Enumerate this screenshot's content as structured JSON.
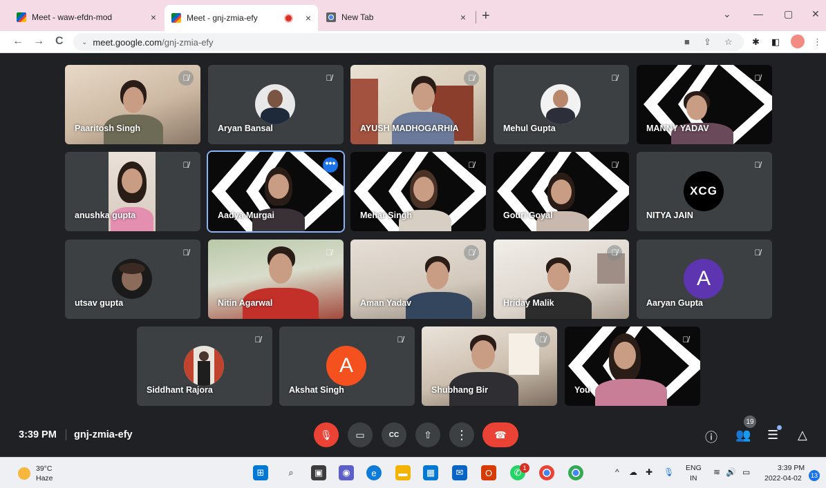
{
  "browser": {
    "tabs": [
      {
        "title": "Meet - waw-efdn-mod",
        "close": "×"
      },
      {
        "title": "Meet - gnj-zmia-efy",
        "close": "×"
      },
      {
        "title": "New Tab",
        "close": "×"
      }
    ],
    "new_tab": "+",
    "window_controls": {
      "dropdown": "⌄",
      "minimize": "—",
      "maximize": "▢",
      "close": "✕"
    },
    "nav": {
      "back": "←",
      "forward": "→",
      "reload": "C"
    },
    "url_host": "meet.google.com",
    "url_path": "/gnj-zmia-efy",
    "url_chevron": "⌄"
  },
  "tiles": [
    {
      "name": "Paaritosh Singh",
      "kind": "video-room"
    },
    {
      "name": "Aryan Bansal",
      "kind": "photo"
    },
    {
      "name": "AYUSH MADHOGARHIA",
      "kind": "video-room"
    },
    {
      "name": "Mehul Gupta",
      "kind": "photo"
    },
    {
      "name": "MANNY YADAV",
      "kind": "video-chevron"
    },
    {
      "name": "anushka gupta",
      "kind": "video-portrait"
    },
    {
      "name": "Aadya Murgai",
      "kind": "video-chevron",
      "active": true,
      "menu": "•••"
    },
    {
      "name": "Mehar Singh",
      "kind": "video-chevron"
    },
    {
      "name": "Gouri Goyal",
      "kind": "video-chevron"
    },
    {
      "name": "NITYA JAIN",
      "kind": "logo",
      "logo_text": "XCG"
    },
    {
      "name": "utsav gupta",
      "kind": "photo"
    },
    {
      "name": "Nitin Agarwal",
      "kind": "video-green"
    },
    {
      "name": "Aman Yadav",
      "kind": "video-room"
    },
    {
      "name": "Hriday Malik",
      "kind": "video-room"
    },
    {
      "name": "Aaryan Gupta",
      "kind": "letter",
      "letter": "A",
      "color": "#5e35b1"
    },
    {
      "name": "Siddhant Rajora",
      "kind": "photo"
    },
    {
      "name": "Akshat Singh",
      "kind": "letter",
      "letter": "A",
      "color": "#f4511e"
    },
    {
      "name": "Shubhang Bir",
      "kind": "video-room"
    },
    {
      "name": "You",
      "kind": "video-chevron"
    }
  ],
  "meetbar": {
    "time": "3:39 PM",
    "meeting_code": "gnj-zmia-efy",
    "participant_count": "19",
    "icons": {
      "mic": "🎙",
      "camera": "▭",
      "captions": "CC",
      "present": "⇧",
      "more": "⋮",
      "hangup": "☎",
      "info": "ⓘ",
      "people": "👥",
      "chat": "☰",
      "activities": "△"
    }
  },
  "taskbar": {
    "weather_temp": "39°C",
    "weather_cond": "Haze",
    "whatsapp_badge": "1",
    "lang_line1": "ENG",
    "lang_line2": "IN",
    "clock_time": "3:39 PM",
    "clock_date": "2022-04-02",
    "notifications": "13",
    "tray_chevron": "^"
  },
  "colors": {
    "meet_bg": "#202124",
    "tile_bg": "#3c4043",
    "hangup": "#ea4335",
    "active_outline": "#8ab4f8",
    "tab_strip": "#f5dbe6"
  }
}
